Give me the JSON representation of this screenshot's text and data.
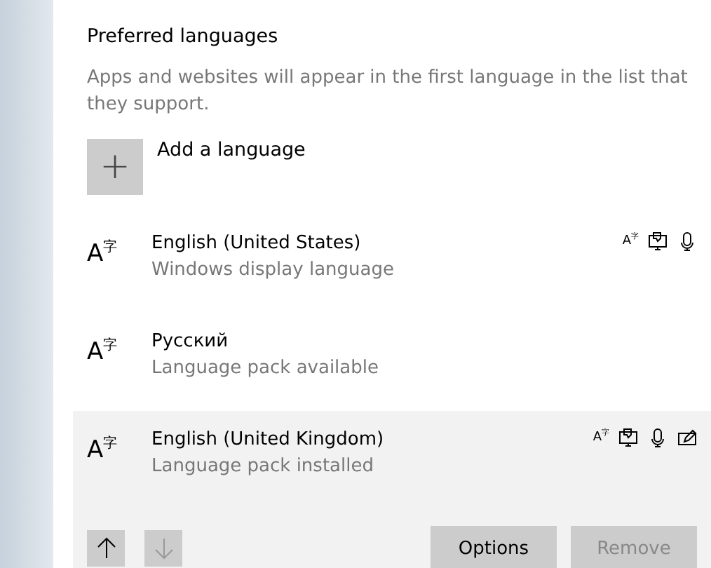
{
  "heading": "Preferred languages",
  "description": "Apps and websites will appear in the first language in the list that they support.",
  "add_button": {
    "label": "Add a language",
    "icon": "+"
  },
  "languages": [
    {
      "glyph": "A$^{字}$",
      "name": "English (United States)",
      "status": "Windows display language",
      "selected": false,
      "features": [
        {
          "kind": "text",
          "glyph": "A$^{字}$"
        },
        {
          "kind": "display"
        },
        {
          "kind": "speech"
        }
      ]
    },
    {
      "glyph": "A$^{字}$",
      "name": "Русский",
      "status": "Language pack available",
      "selected": false
    },
    {
      "glyph": "A$^{字}$",
      "name": "English (United Kingdom)",
      "status": "Language pack installed",
      "selected": true,
      "features": [
        {
          "kind": "text",
          "glyph": "A$^{字}$"
        },
        {
          "kind": "display"
        },
        {
          "kind": "speech"
        },
        {
          "kind": "handwriting"
        }
      ]
    }
  ],
  "move_up": {
    "disabled": false
  },
  "move_down": {
    "disabled": true
  },
  "buttons": [
    {
      "label": "Options",
      "disabled": false
    },
    {
      "label": "Remove",
      "disabled": true
    }
  ]
}
